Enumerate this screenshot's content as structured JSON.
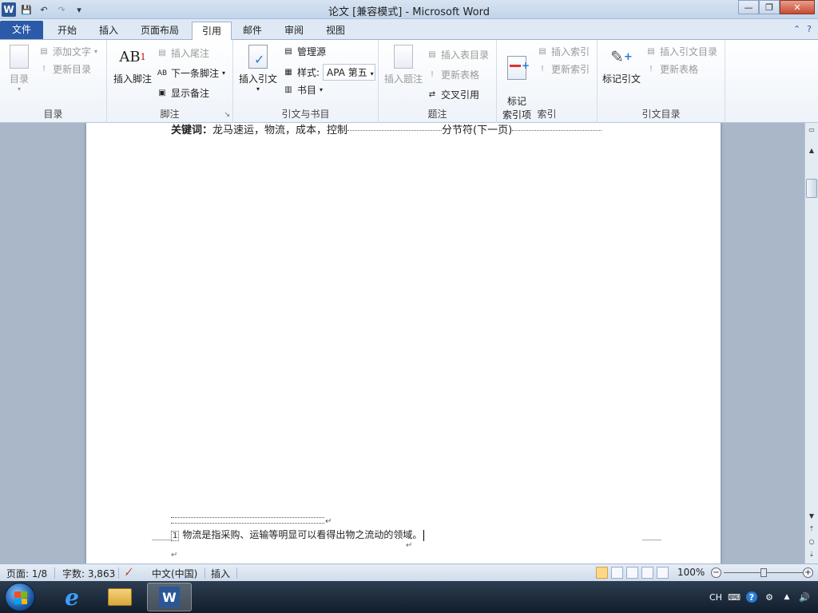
{
  "window": {
    "title": "论文 [兼容模式] - Microsoft Word",
    "app_icon_letter": "W"
  },
  "qat": {
    "save": "💾",
    "undo": "↶",
    "redo": "↷",
    "customize": "▾"
  },
  "window_controls": {
    "minimize": "—",
    "maximize": "❐",
    "close": "✕"
  },
  "tabs": [
    {
      "label": "文件"
    },
    {
      "label": "开始"
    },
    {
      "label": "插入"
    },
    {
      "label": "页面布局"
    },
    {
      "label": "引用"
    },
    {
      "label": "邮件"
    },
    {
      "label": "审阅"
    },
    {
      "label": "视图"
    }
  ],
  "ribbon_help": {
    "collapse": "⌃",
    "help": "?"
  },
  "ribbon": {
    "toc": {
      "label": "目录",
      "big": "目录",
      "add_text": "添加文字",
      "update": "更新目录"
    },
    "footnotes": {
      "label": "脚注",
      "insert_footnote": "插入脚注",
      "insert_endnote": "插入尾注",
      "next_footnote": "下一条脚注",
      "show_notes": "显示备注",
      "ab_glyph": "AB",
      "ab_sup": "1"
    },
    "citations": {
      "label": "引文与书目",
      "insert_citation": "插入引文",
      "manage_sources": "管理源",
      "style_label": "样式:",
      "style_value": "APA 第五",
      "bibliography": "书目"
    },
    "captions": {
      "label": "题注",
      "insert_caption": "插入题注",
      "insert_table_figures": "插入表目录",
      "update_table": "更新表格",
      "cross_reference": "交叉引用"
    },
    "index": {
      "label": "索引",
      "mark_entry": "标记\n索引项",
      "insert_index": "插入索引",
      "update_index": "更新索引"
    },
    "toa": {
      "label": "引文目录",
      "mark_citation": "标记引文",
      "insert_toa": "插入引文目录",
      "update_table": "更新表格"
    }
  },
  "document": {
    "keywords_label": "关键词：",
    "keywords_text": "龙马速运，物流，成本，控制",
    "section_break": "分节符(下一页)",
    "footnote_number": "1",
    "footnote_text": "物流是指采购、运输等明显可以看得出物之流动的领域。",
    "para_mark": "↵"
  },
  "status": {
    "page": "页面: 1/8",
    "words": "字数: 3,863",
    "language": "中文(中国)",
    "mode": "插入",
    "zoom": "100%",
    "zoom_fraction": 0.5
  },
  "taskbar": {
    "tray_lang": "CH",
    "tray_help": "?",
    "tray_up": "▲",
    "tray_volume": "🔊"
  },
  "colors": {
    "file_tab": "#2a5aa8",
    "doc_bg": "#a9b7c9",
    "taskbar": "#1a2736"
  }
}
